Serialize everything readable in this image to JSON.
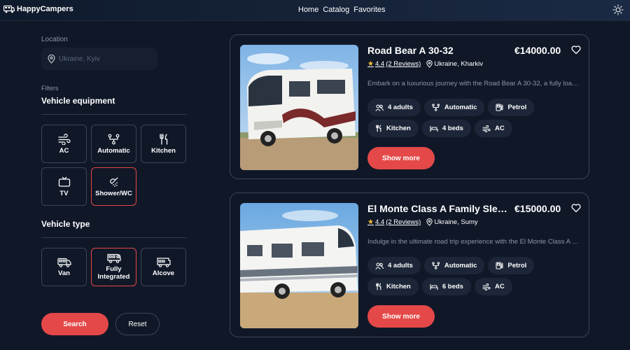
{
  "app": {
    "logo_text": "HappyCampers"
  },
  "nav": {
    "home": "Home",
    "catalog": "Catalog",
    "favorites": "Favorites"
  },
  "sidebar": {
    "location_label": "Location",
    "location_placeholder": "Ukraine, Kyiv",
    "filters_label": "Filters",
    "equipment_title": "Vehicle equipment",
    "equipment": [
      {
        "label": "AC",
        "icon": "wind-icon",
        "selected": false
      },
      {
        "label": "Automatic",
        "icon": "diagram-icon",
        "selected": false
      },
      {
        "label": "Kitchen",
        "icon": "cup-icon",
        "selected": false
      },
      {
        "label": "TV",
        "icon": "tv-icon",
        "selected": false
      },
      {
        "label": "Shower/WC",
        "icon": "shower-icon",
        "selected": true
      }
    ],
    "type_title": "Vehicle type",
    "types": [
      {
        "label": "Van",
        "icon": "van-icon",
        "selected": false
      },
      {
        "label": "Fully Integrated",
        "icon": "camper-icon",
        "selected": true
      },
      {
        "label": "Alcove",
        "icon": "alcove-icon",
        "selected": false
      }
    ],
    "search_label": "Search",
    "reset_label": "Reset"
  },
  "campers": [
    {
      "title": "Road Bear A 30-32",
      "price": "€14000.00",
      "rating": "4.4",
      "reviews": "(2 Reviews)",
      "location": "Ukraine, Kharkiv",
      "description": "Embark on a luxurious journey with the Road Bear A 30-32, a fully loaded motorhome",
      "features": {
        "adults": "4 adults",
        "transmission": "Automatic",
        "engine": "Petrol",
        "kitchen": "Kitchen",
        "beds": "4 beds",
        "ac": "AC"
      },
      "button": "Show more"
    },
    {
      "title": "El Monte Class A Family Sleeper",
      "price": "€15000.00",
      "rating": "4.4",
      "reviews": "(2 Reviews)",
      "location": "Ukraine, Sumy",
      "description": "Indulge in the ultimate road trip experience with the El Monte Class A Family Sleeper",
      "features": {
        "adults": "4 adults",
        "transmission": "Automatic",
        "engine": "Petrol",
        "kitchen": "Kitchen",
        "beds": "6 beds",
        "ac": "AC"
      },
      "button": "Show more"
    }
  ],
  "colors": {
    "background": "#101828",
    "accent": "#e44848",
    "star": "#ffc531",
    "muted": "#8b93a7"
  }
}
